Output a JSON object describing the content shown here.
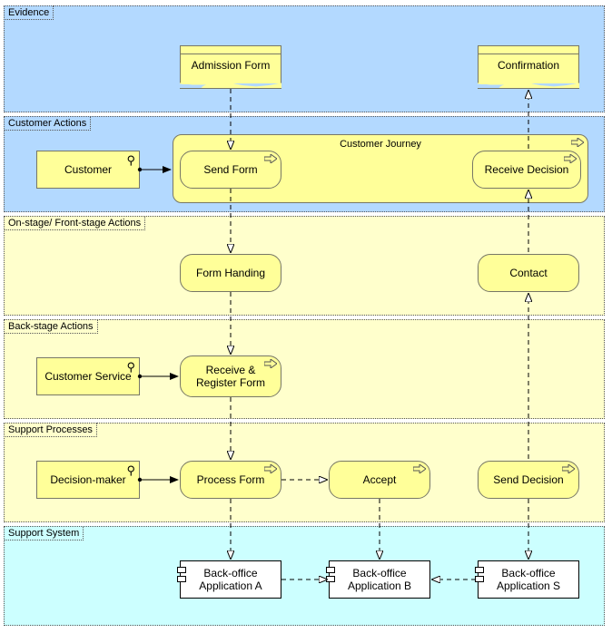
{
  "lanes": {
    "evidence": "Evidence",
    "customerActions": "Customer Actions",
    "onstage": "On-stage/ Front-stage Actions",
    "backstage": "Back-stage Actions",
    "support": "Support Processes",
    "system": "Support System"
  },
  "journey": "Customer Journey",
  "docs": {
    "admission": "Admission Form",
    "confirmation": "Confirmation"
  },
  "actors": {
    "customer": "Customer",
    "service": "Customer Service",
    "decision": "Decision-maker"
  },
  "acts": {
    "send": "Send Form",
    "receive": "Receive Decision",
    "handing": "Form Handing",
    "contact": "Contact",
    "register": "Receive & Register Form",
    "process": "Process Form",
    "accept": "Accept",
    "sendDec": "Send Decision"
  },
  "apps": {
    "a": "Back-office Application A",
    "b": "Back-office Application B",
    "s": "Back-office Application S"
  }
}
